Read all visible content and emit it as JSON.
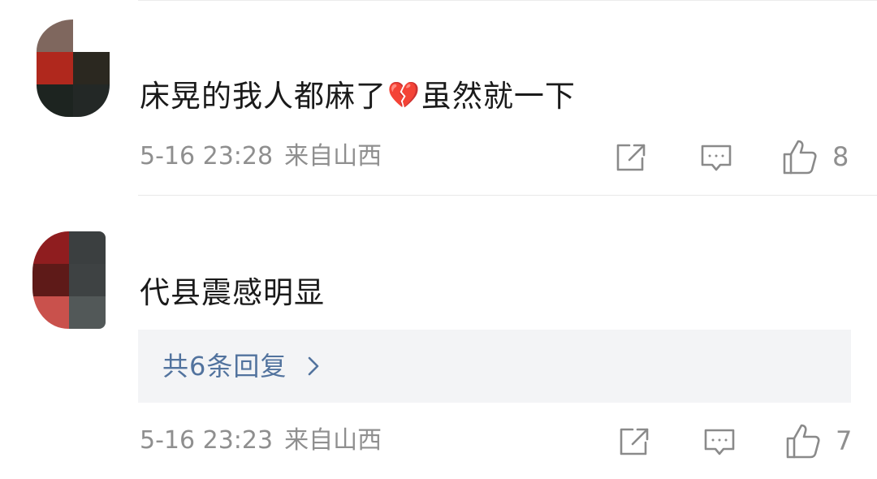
{
  "comments": [
    {
      "text_before_emoji": "床晃的我人都麻了",
      "emoji": "💔",
      "text_after_emoji": "虽然就一下",
      "timestamp": "5-16 23:28",
      "location": "来自山西",
      "likes": "8"
    },
    {
      "text": "代县震感明显",
      "replies_label": "共6条回复",
      "timestamp": "5-16 23:23",
      "location": "来自山西",
      "likes": "7"
    }
  ],
  "colors": {
    "text": "#1a1a1a",
    "meta": "#8f8f8f",
    "reply_link": "#52739e",
    "reply_bg": "#f3f4f6",
    "broken_heart": "#e0303f"
  }
}
